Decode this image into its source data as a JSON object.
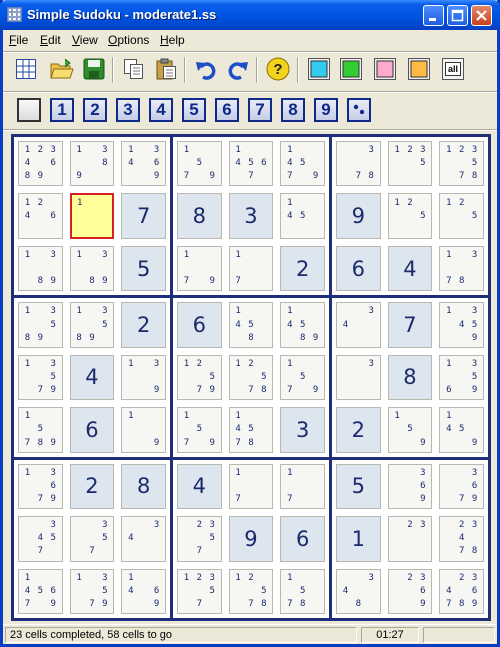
{
  "window": {
    "title": "Simple Sudoku - moderate1.ss"
  },
  "menu": [
    {
      "label": "File",
      "key": "F"
    },
    {
      "label": "Edit",
      "key": "E"
    },
    {
      "label": "View",
      "key": "V"
    },
    {
      "label": "Options",
      "key": "O"
    },
    {
      "label": "Help",
      "key": "H"
    }
  ],
  "toolbar": {
    "all_label": "all",
    "colors": {
      "cyan": "#33CCEE",
      "green": "#33CC33",
      "pink": "#FFAACC",
      "orange": "#FFBB44"
    }
  },
  "numbers": [
    "1",
    "2",
    "3",
    "4",
    "5",
    "6",
    "7",
    "8",
    "9"
  ],
  "grid": [
    [
      {
        "c": "1234 689"
      },
      {
        "c": "1 3  89"
      },
      {
        "c": "1 34 6  9"
      },
      {
        "c": "1   5 7 9"
      },
      {
        "c": "1  456 7"
      },
      {
        "c": "1  45 7 9"
      },
      {
        "c": "  3    78"
      },
      {
        "c": "123  5"
      },
      {
        "c": "123  5 78"
      }
    ],
    [
      {
        "c": "12 4 6"
      },
      {
        "c": "1",
        "sel": true
      },
      {
        "v": "7"
      },
      {
        "v": "8"
      },
      {
        "v": "3"
      },
      {
        "c": "1  45"
      },
      {
        "v": "9"
      },
      {
        "c": "12   5"
      },
      {
        "c": "12   5"
      }
    ],
    [
      {
        "c": "1 3    89"
      },
      {
        "c": "1 3    89"
      },
      {
        "v": "5"
      },
      {
        "c": "1     7 9"
      },
      {
        "c": "1     7"
      },
      {
        "v": "2"
      },
      {
        "v": "6"
      },
      {
        "v": "4"
      },
      {
        "c": "1 3   78"
      }
    ],
    [
      {
        "c": "1 3  589"
      },
      {
        "c": "1 3  589"
      },
      {
        "v": "2"
      },
      {
        "v": "6"
      },
      {
        "c": "1  45  8"
      },
      {
        "c": "1  45  89"
      },
      {
        "c": "  34"
      },
      {
        "v": "7"
      },
      {
        "c": "1 3 45  9"
      }
    ],
    [
      {
        "c": "1 3  5 79"
      },
      {
        "v": "4"
      },
      {
        "c": "1 3     9"
      },
      {
        "c": "12   5 79"
      },
      {
        "c": "12   5 78"
      },
      {
        "c": "1   5 7 9"
      },
      {
        "c": "  3"
      },
      {
        "v": "8"
      },
      {
        "c": "1 3  56 9"
      }
    ],
    [
      {
        "c": "1   5 789"
      },
      {
        "v": "6"
      },
      {
        "c": "1       9"
      },
      {
        "c": "1   5 7 9"
      },
      {
        "c": "1  45 78"
      },
      {
        "v": "3"
      },
      {
        "v": "2"
      },
      {
        "c": "1   5   9"
      },
      {
        "c": "1  45   9"
      }
    ],
    [
      {
        "c": "1 3  6 79"
      },
      {
        "v": "2"
      },
      {
        "v": "8"
      },
      {
        "v": "4"
      },
      {
        "c": "1     7"
      },
      {
        "c": "1     7"
      },
      {
        "v": "5"
      },
      {
        "c": "  3  6  9"
      },
      {
        "c": "  3  6 79"
      }
    ],
    [
      {
        "c": "  3 45 7"
      },
      {
        "c": "  3  5 7"
      },
      {
        "c": "  34"
      },
      {
        "c": " 23  5 7"
      },
      {
        "v": "9"
      },
      {
        "v": "6"
      },
      {
        "v": "1"
      },
      {
        "c": " 23"
      },
      {
        "c": " 23 4  78"
      }
    ],
    [
      {
        "c": "1  4567 9"
      },
      {
        "c": "1 3  5 79"
      },
      {
        "c": "1  4 6  9"
      },
      {
        "c": "123  5 7"
      },
      {
        "c": "12   5 78"
      },
      {
        "c": "1   5 78"
      },
      {
        "c": "  34   8"
      },
      {
        "c": " 23  6  9"
      },
      {
        "c": " 234 6789"
      }
    ]
  ],
  "status": {
    "progress": "23 cells completed, 58 cells to go",
    "time": "01:27"
  }
}
